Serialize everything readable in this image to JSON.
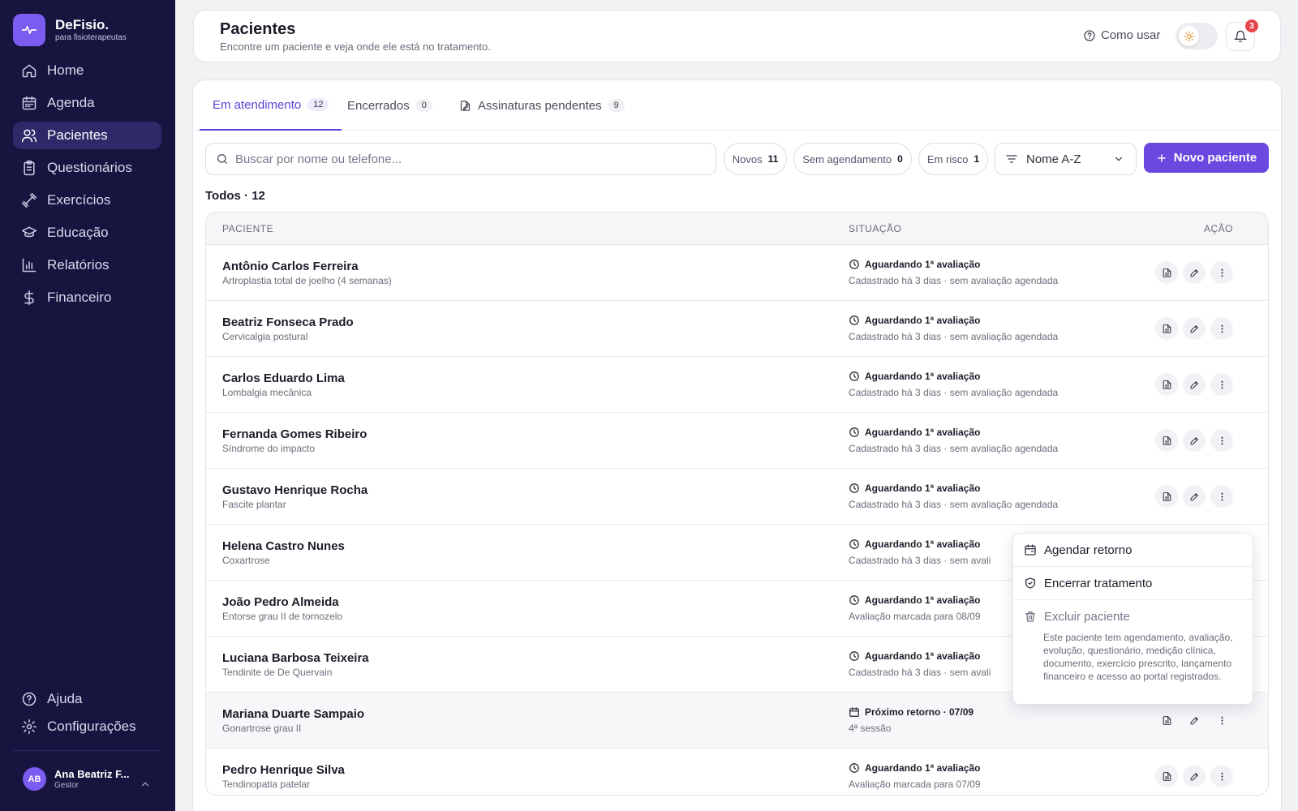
{
  "brand": {
    "name": "DeFisio.",
    "tagline": "para fisioterapeutas"
  },
  "nav": [
    {
      "label": "Home",
      "icon": "home-icon"
    },
    {
      "label": "Agenda",
      "icon": "calendar-icon"
    },
    {
      "label": "Pacientes",
      "icon": "users-icon",
      "active": true
    },
    {
      "label": "Questionários",
      "icon": "clipboard-icon"
    },
    {
      "label": "Exercícios",
      "icon": "dumbbell-icon"
    },
    {
      "label": "Educação",
      "icon": "graduation-cap-icon"
    },
    {
      "label": "Relatórios",
      "icon": "bar-chart-icon"
    },
    {
      "label": "Financeiro",
      "icon": "dollar-icon"
    }
  ],
  "nav_bottom": [
    {
      "label": "Ajuda",
      "icon": "help-circle-icon"
    },
    {
      "label": "Configurações",
      "icon": "gear-icon"
    }
  ],
  "user": {
    "initials": "AB",
    "name": "Ana Beatriz F...",
    "role": "Gestor"
  },
  "header": {
    "title": "Pacientes",
    "subtitle": "Encontre um paciente e veja onde ele está no tratamento.",
    "howto": "Como usar",
    "notifications": "3"
  },
  "tabs": [
    {
      "label": "Em atendimento",
      "count": "12",
      "active": true
    },
    {
      "label": "Encerrados",
      "count": "0"
    },
    {
      "label": "Assinaturas pendentes",
      "count": "9"
    }
  ],
  "search": {
    "placeholder": "Buscar por nome ou telefone..."
  },
  "filters": [
    {
      "label": "Novos",
      "count": "11"
    },
    {
      "label": "Sem agendamento",
      "count": "0"
    },
    {
      "label": "Em risco",
      "count": "1"
    }
  ],
  "sort": {
    "value": "Nome A-Z"
  },
  "new_patient": "Novo paciente",
  "list_count": "Todos · 12",
  "table": {
    "headers": {
      "patient": "PACIENTE",
      "status": "SITUAÇÃO",
      "action": "AÇÃO"
    },
    "rows": [
      {
        "name": "Antônio Carlos Ferreira",
        "diagnosis": "Artroplastia total de joelho (4 semanas)",
        "status": "Aguardando 1ª avaliação",
        "status_icon": "clock-icon",
        "detail": "Cadastrado há 3 dias · sem avaliação agendada"
      },
      {
        "name": "Beatriz Fonseca Prado",
        "diagnosis": "Cervicalgia postural",
        "status": "Aguardando 1ª avaliação",
        "status_icon": "clock-icon",
        "detail": "Cadastrado há 3 dias · sem avaliação agendada"
      },
      {
        "name": "Carlos Eduardo Lima",
        "diagnosis": "Lombalgia mecânica",
        "status": "Aguardando 1ª avaliação",
        "status_icon": "clock-icon",
        "detail": "Cadastrado há 3 dias · sem avaliação agendada"
      },
      {
        "name": "Fernanda Gomes Ribeiro",
        "diagnosis": "Síndrome do impacto",
        "status": "Aguardando 1ª avaliação",
        "status_icon": "clock-icon",
        "detail": "Cadastrado há 3 dias · sem avaliação agendada"
      },
      {
        "name": "Gustavo Henrique Rocha",
        "diagnosis": "Fascite plantar",
        "status": "Aguardando 1ª avaliação",
        "status_icon": "clock-icon",
        "detail": "Cadastrado há 3 dias · sem avaliação agendada"
      },
      {
        "name": "Helena Castro Nunes",
        "diagnosis": "Coxartrose",
        "status": "Aguardando 1ª avaliação",
        "status_icon": "clock-icon",
        "detail": "Cadastrado há 3 dias · sem avali"
      },
      {
        "name": "João Pedro Almeida",
        "diagnosis": "Entorse grau II de tornozelo",
        "status": "Aguardando 1ª avaliação",
        "status_icon": "clock-icon",
        "detail": "Avaliação marcada para 08/09"
      },
      {
        "name": "Luciana Barbosa Teixeira",
        "diagnosis": "Tendinite de De Quervain",
        "status": "Aguardando 1ª avaliação",
        "status_icon": "clock-icon",
        "detail": "Cadastrado há 3 dias · sem avali"
      },
      {
        "name": "Mariana Duarte Sampaio",
        "diagnosis": "Gonartrose grau II",
        "status": "Próximo retorno · 07/09",
        "status_icon": "calendar-icon",
        "detail": "4ª sessão",
        "highlight": true
      },
      {
        "name": "Pedro Henrique Silva",
        "diagnosis": "Tendinopatia patelar",
        "status": "Aguardando 1ª avaliação",
        "status_icon": "clock-icon",
        "detail": "Avaliação marcada para 07/09"
      }
    ]
  },
  "menu": {
    "schedule": "Agendar retorno",
    "close_treatment": "Encerrar tratamento",
    "delete": "Excluir paciente",
    "delete_note": "Este paciente tem agendamento, avaliação, evolução, questionário, medição clínica, documento, exercício prescrito, lançamento financeiro e acesso ao portal registrados."
  },
  "colors": {
    "sidebar": "#17143f",
    "accent": "#6b48e0",
    "badge": "#e5484d"
  }
}
